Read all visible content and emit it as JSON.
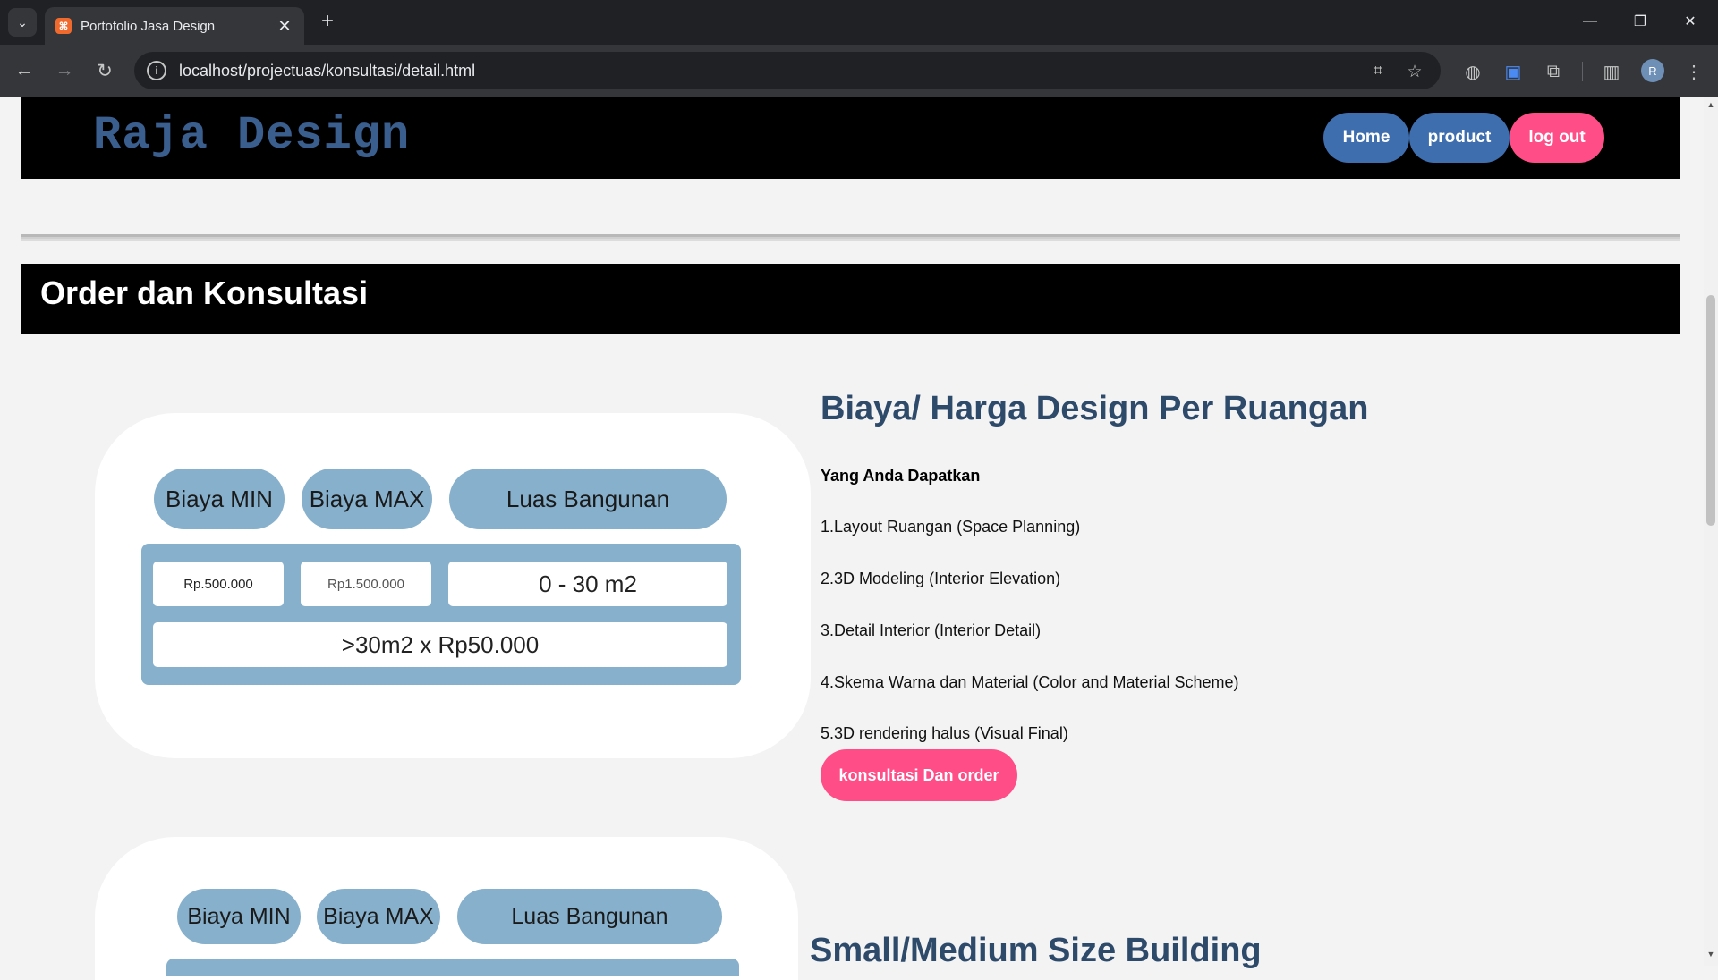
{
  "browser": {
    "tab_title": "Portofolio Jasa Design",
    "favicon_glyph": "⌘",
    "url": "localhost/projectuas/konsultasi/detail.html",
    "avatar_initial": "R"
  },
  "site": {
    "logo": "Raja Design",
    "nav": {
      "home": "Home",
      "product": "product",
      "logout": "log out"
    },
    "section_title": "Order dan Konsultasi"
  },
  "cards": [
    {
      "labels": [
        "Biaya MIN",
        "Biaya MAX",
        "Luas Bangunan"
      ],
      "min_price": "Rp.500.000",
      "max_price": "Rp1.500.000",
      "area": "0 - 30 m2",
      "extra": ">30m2 x Rp50.000"
    },
    {
      "labels": [
        "Biaya MIN",
        "Biaya MAX",
        "Luas Bangunan"
      ]
    }
  ],
  "detail": {
    "heading": "Biaya/ Harga Design Per Ruangan",
    "subheading": "Yang Anda Dapatkan",
    "items": [
      "1.Layout Ruangan (Space Planning)",
      "2.3D Modeling (Interior Elevation)",
      "3.Detail Interior (Interior Detail)",
      "4.Skema Warna dan Material (Color and Material Scheme)",
      "5.3D rendering halus (Visual Final)"
    ],
    "cta": "konsultasi Dan order",
    "next_heading": "Small/Medium Size Building"
  },
  "colors": {
    "header_bg": "#000000",
    "logo": "#3a5f8f",
    "nav_blue": "#3e6eae",
    "accent_pink": "#ff4d88",
    "pill_blue": "#86b0cc",
    "heading_blue": "#2e4a6b"
  }
}
